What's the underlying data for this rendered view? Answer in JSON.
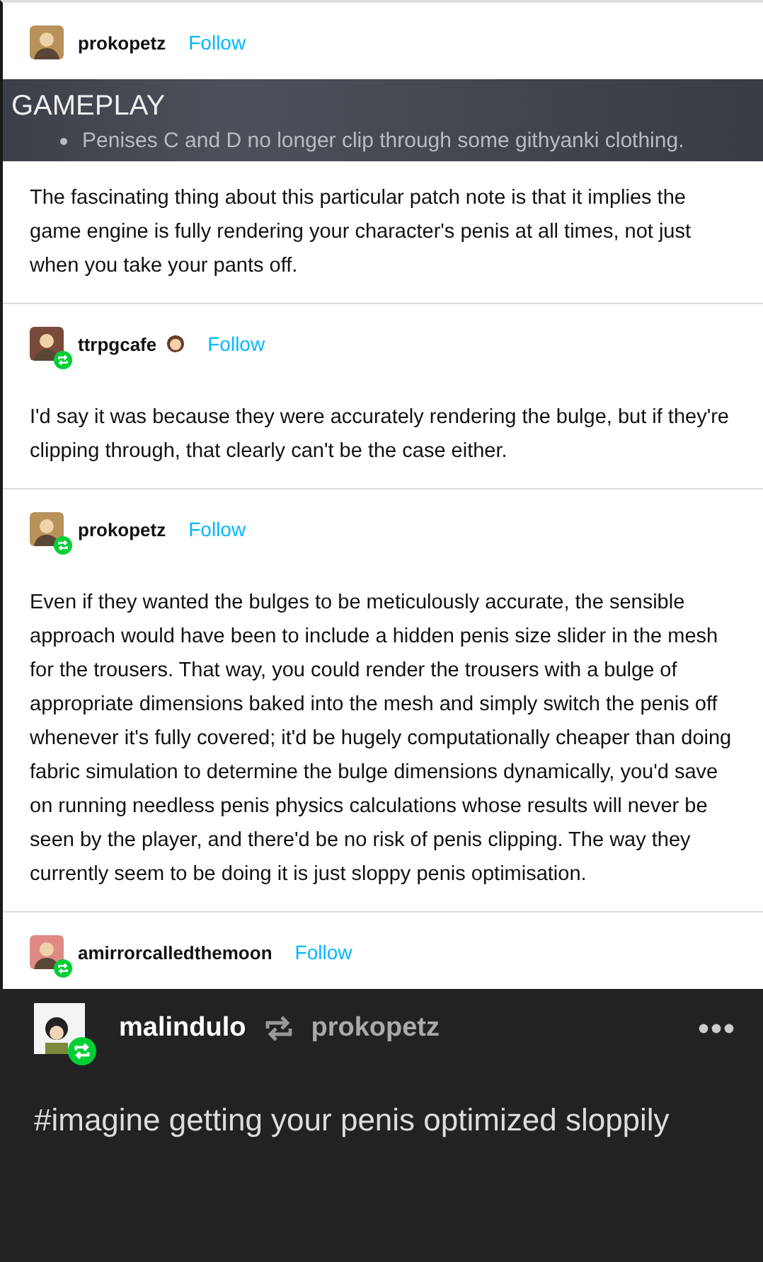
{
  "posts": [
    {
      "username": "prokopetz",
      "follow": "Follow",
      "reblogged": false,
      "has_badge_icon": false,
      "screenshot": {
        "heading": "GAMEPLAY",
        "bullet": "Penises C and D no longer clip through some githyanki clothing."
      },
      "body": "The fascinating thing about this particular patch note is that it implies the game engine is fully rendering your character's penis at all times, not just when you take your pants off."
    },
    {
      "username": "ttrpgcafe",
      "follow": "Follow",
      "reblogged": true,
      "has_badge_icon": true,
      "body": "I'd say it was because they were accurately rendering the bulge, but if they're clipping through, that clearly can't be the case either."
    },
    {
      "username": "prokopetz",
      "follow": "Follow",
      "reblogged": true,
      "has_badge_icon": false,
      "body": "Even if they wanted the bulges to be meticulously accurate, the sensible approach would have been to include a hidden penis size slider in the mesh for the trousers. That way, you could render the trousers with a bulge of appropriate dimensions baked into the mesh and simply switch the penis off whenever it's fully covered; it'd be hugely computationally cheaper than doing fabric simulation to determine the bulge dimensions dynamically, you'd save on running needless penis physics calculations whose results will never be seen by the player, and there'd be no risk of penis clipping. The way they currently seem to be doing it is just sloppy penis optimisation."
    },
    {
      "username": "amirrorcalledthemoon",
      "follow": "Follow",
      "reblogged": true,
      "has_badge_icon": false
    }
  ],
  "reblog": {
    "username": "malindulo",
    "reblogged_from": "prokopetz",
    "reblogged": true,
    "tags": "#imagine getting your penis optimized sloppily"
  }
}
